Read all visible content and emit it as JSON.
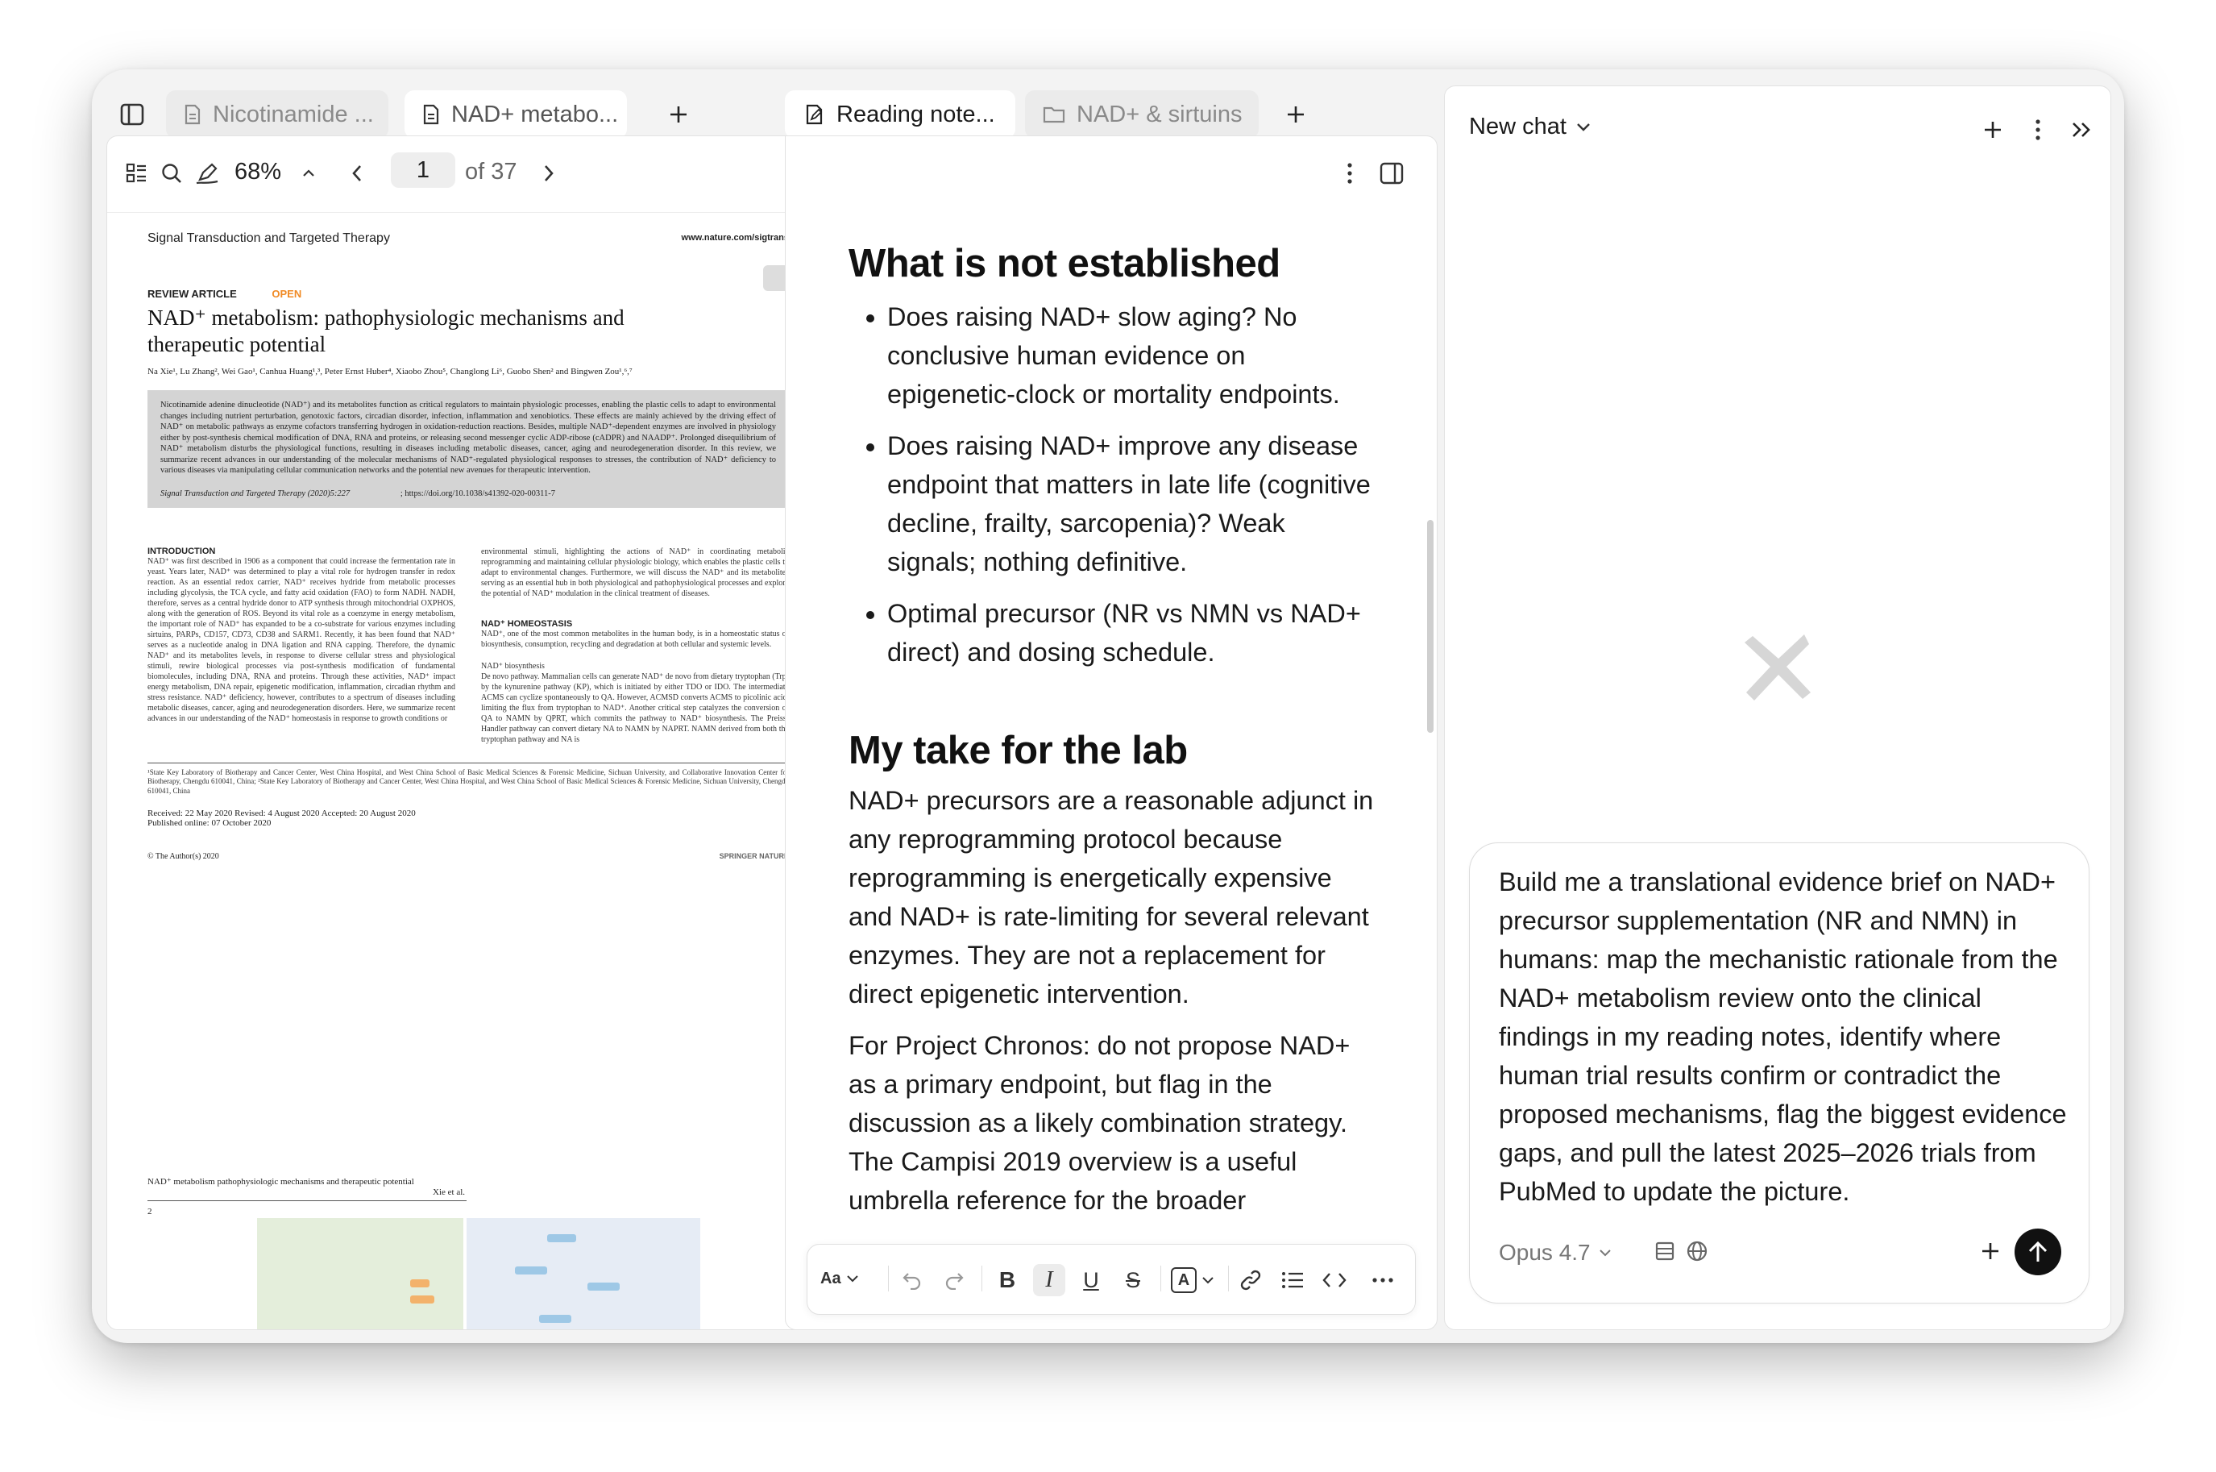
{
  "left_pane": {
    "tabs": [
      {
        "label": "Nicotinamide ...",
        "active": false
      },
      {
        "label": "NAD+ metabo...",
        "active": true
      }
    ],
    "toolbar": {
      "zoom": "68%",
      "page_current": "1",
      "page_total": "of 37"
    },
    "pdf": {
      "journal": "Signal Transduction and Targeted Therapy",
      "journal_url": "www.nature.com/sigtrans",
      "article_type": "REVIEW ARTICLE",
      "open_label": "OPEN",
      "title_line1": "NAD⁺ metabolism: pathophysiologic mechanisms and",
      "title_line2": "therapeutic potential",
      "authors": "Na Xie¹, Lu Zhang², Wei Gao¹, Canhua Huang¹,³, Peter Ernst Huber⁴, Xiaobo Zhou⁵, Changlong Li⁶, Guobo Shen² and Bingwen Zou¹,⁶,⁷",
      "abstract": "Nicotinamide adenine dinucleotide (NAD⁺) and its metabolites function as critical regulators to maintain physiologic processes, enabling the plastic cells to adapt to environmental changes including nutrient perturbation, genotoxic factors, circadian disorder, infection, inflammation and xenobiotics. These effects are mainly achieved by the driving effect of NAD⁺ on metabolic pathways as enzyme cofactors transferring hydrogen in oxidation-reduction reactions. Besides, multiple NAD⁺-dependent enzymes are involved in physiology either by post-synthesis chemical modification of DNA, RNA and proteins, or releasing second messenger cyclic ADP-ribose (cADPR) and NAADP⁺. Prolonged disequilibrium of NAD⁺ metabolism disturbs the physiological functions, resulting in diseases including metabolic diseases, cancer, aging and neurodegeneration disorder. In this review, we summarize recent advances in our understanding of the molecular mechanisms of NAD⁺-regulated physiological responses to stresses, the contribution of NAD⁺ deficiency to various diseases via manipulating cellular communication networks and the potential new avenues for therapeutic intervention.",
      "citation": "Signal Transduction and Targeted Therapy (2020)5:227",
      "doi": "; https://doi.org/10.1038/s41392-020-00311-7",
      "intro_heading": "INTRODUCTION",
      "intro_text": "NAD⁺ was first described in 1906 as a component that could increase the fermentation rate in yeast. Years later, NAD⁺ was determined to play a vital role for hydrogen transfer in redox reaction. As an essential redox carrier, NAD⁺ receives hydride from metabolic processes including glycolysis, the TCA cycle, and fatty acid oxidation (FAO) to form NADH. NADH, therefore, serves as a central hydride donor to ATP synthesis through mitochondrial OXPHOS, along with the generation of ROS. Beyond its vital role as a coenzyme in energy metabolism, the important role of NAD⁺ has expanded to be a co-substrate for various enzymes including sirtuins, PARPs, CD157, CD73, CD38 and SARM1. Recently, it has been found that NAD⁺ serves as a nucleotide analog in DNA ligation and RNA capping. Therefore, the dynamic NAD⁺ and its metabolites levels, in response to diverse cellular stress and physiological stimuli, rewire biological processes via post-synthesis modification of fundamental biomolecules, including DNA, RNA and proteins. Through these activities, NAD⁺ impact energy metabolism, DNA repair, epigenetic modification, inflammation, circadian rhythm and stress resistance. NAD⁺ deficiency, however, contributes to a spectrum of diseases including metabolic diseases, cancer, aging and neurodegeneration disorders. Here, we summarize recent advances in our understanding of the NAD⁺ homeostasis in response to growth conditions or",
      "col2_text": "environmental stimuli, highlighting the actions of NAD⁺ in coordinating metabolic reprogramming and maintaining cellular physiologic biology, which enables the plastic cells to adapt to environmental changes. Furthermore, we will discuss the NAD⁺ and its metabolites serving as an essential hub in both physiological and pathophysiological processes and explore the potential of NAD⁺ modulation in the clinical treatment of diseases.",
      "homeostasis_heading": "NAD⁺ HOMEOSTASIS",
      "homeostasis_text": "NAD⁺, one of the most common metabolites in the human body, is in a homeostatic status of biosynthesis, consumption, recycling and degradation at both cellular and systemic levels.",
      "biosynthesis_heading": "NAD⁺ biosynthesis",
      "biosynthesis_text": "De novo pathway. Mammalian cells can generate NAD⁺ de novo from dietary tryptophan (Trp) by the kynurenine pathway (KP), which is initiated by either TDO or IDO. The intermediate ACMS can cyclize spontaneously to QA. However, ACMSD converts ACMS to picolinic acid, limiting the flux from tryptophan to NAD⁺. Another critical step catalyzes the conversion of QA to NAMN by QPRT, which commits the pathway to NAD⁺ biosynthesis. The Preiss-Handler pathway can convert dietary NA to NAMN by NAPRT. NAMN derived from both the tryptophan pathway and NA is",
      "affiliations": "¹State Key Laboratory of Biotherapy and Cancer Center, West China Hospital, and West China School of Basic Medical Sciences & Forensic Medicine, Sichuan University, and Collaborative Innovation Center for Biotherapy, Chengdu 610041, China; ²State Key Laboratory of Biotherapy and Cancer Center, West China Hospital, and West China School of Basic Medical Sciences & Forensic Medicine, Sichuan University, Chengdu 610041, China",
      "received": "Received: 22 May 2020 Revised: 4 August 2020 Accepted: 20 August 2020",
      "published": "Published online: 07 October 2020",
      "copyright": "© The Author(s) 2020",
      "publisher": "SPRINGER NATURE",
      "page2_running_title": "NAD⁺ metabolism pathophysiologic mechanisms and therapeutic potential",
      "page2_authors": "Xie et al.",
      "page2_number": "2"
    }
  },
  "middle_pane": {
    "tabs": [
      {
        "label": "Reading note...",
        "active": true
      },
      {
        "label": "NAD+ & sirtuins",
        "active": false
      }
    ],
    "note": {
      "section1_heading": "What is not established",
      "section1_bullets": [
        "Does raising NAD+ slow aging? No conclusive human evidence on epigenetic-clock or mortality endpoints.",
        "Does raising NAD+ improve any disease endpoint that matters in late life (cognitive decline, frailty, sarcopenia)? Weak signals; nothing definitive.",
        "Optimal precursor (NR vs NMN vs NAD+ direct) and dosing schedule."
      ],
      "section2_heading": "My take for the lab",
      "para1": "NAD+ precursors are a reasonable adjunct in any reprogramming protocol because reprogramming is energetically expensive and NAD+ is rate-limiting for several relevant enzymes. They are not a replacement for direct epigenetic intervention.",
      "para2": "For Project Chronos: do not propose NAD+ as a primary endpoint, but flag in the discussion as a likely combination strategy. The Campisi 2019 overview is a useful umbrella reference for the broader translational sci..."
    },
    "format_toolbar": {
      "font_label": "Aa",
      "color_label": "A"
    }
  },
  "chat_pane": {
    "title": "New chat",
    "prompt": "Build me a translational evidence brief on NAD+ precursor supplementation (NR and NMN) in humans: map the mechanistic rationale from the NAD+ metabolism review onto the clinical findings in my reading notes, identify where human trial results confirm or contradict the proposed mechanisms, flag the biggest evidence gaps, and pull the latest 2025–2026 trials from PubMed to update the picture.",
    "model": "Opus 4.7"
  }
}
